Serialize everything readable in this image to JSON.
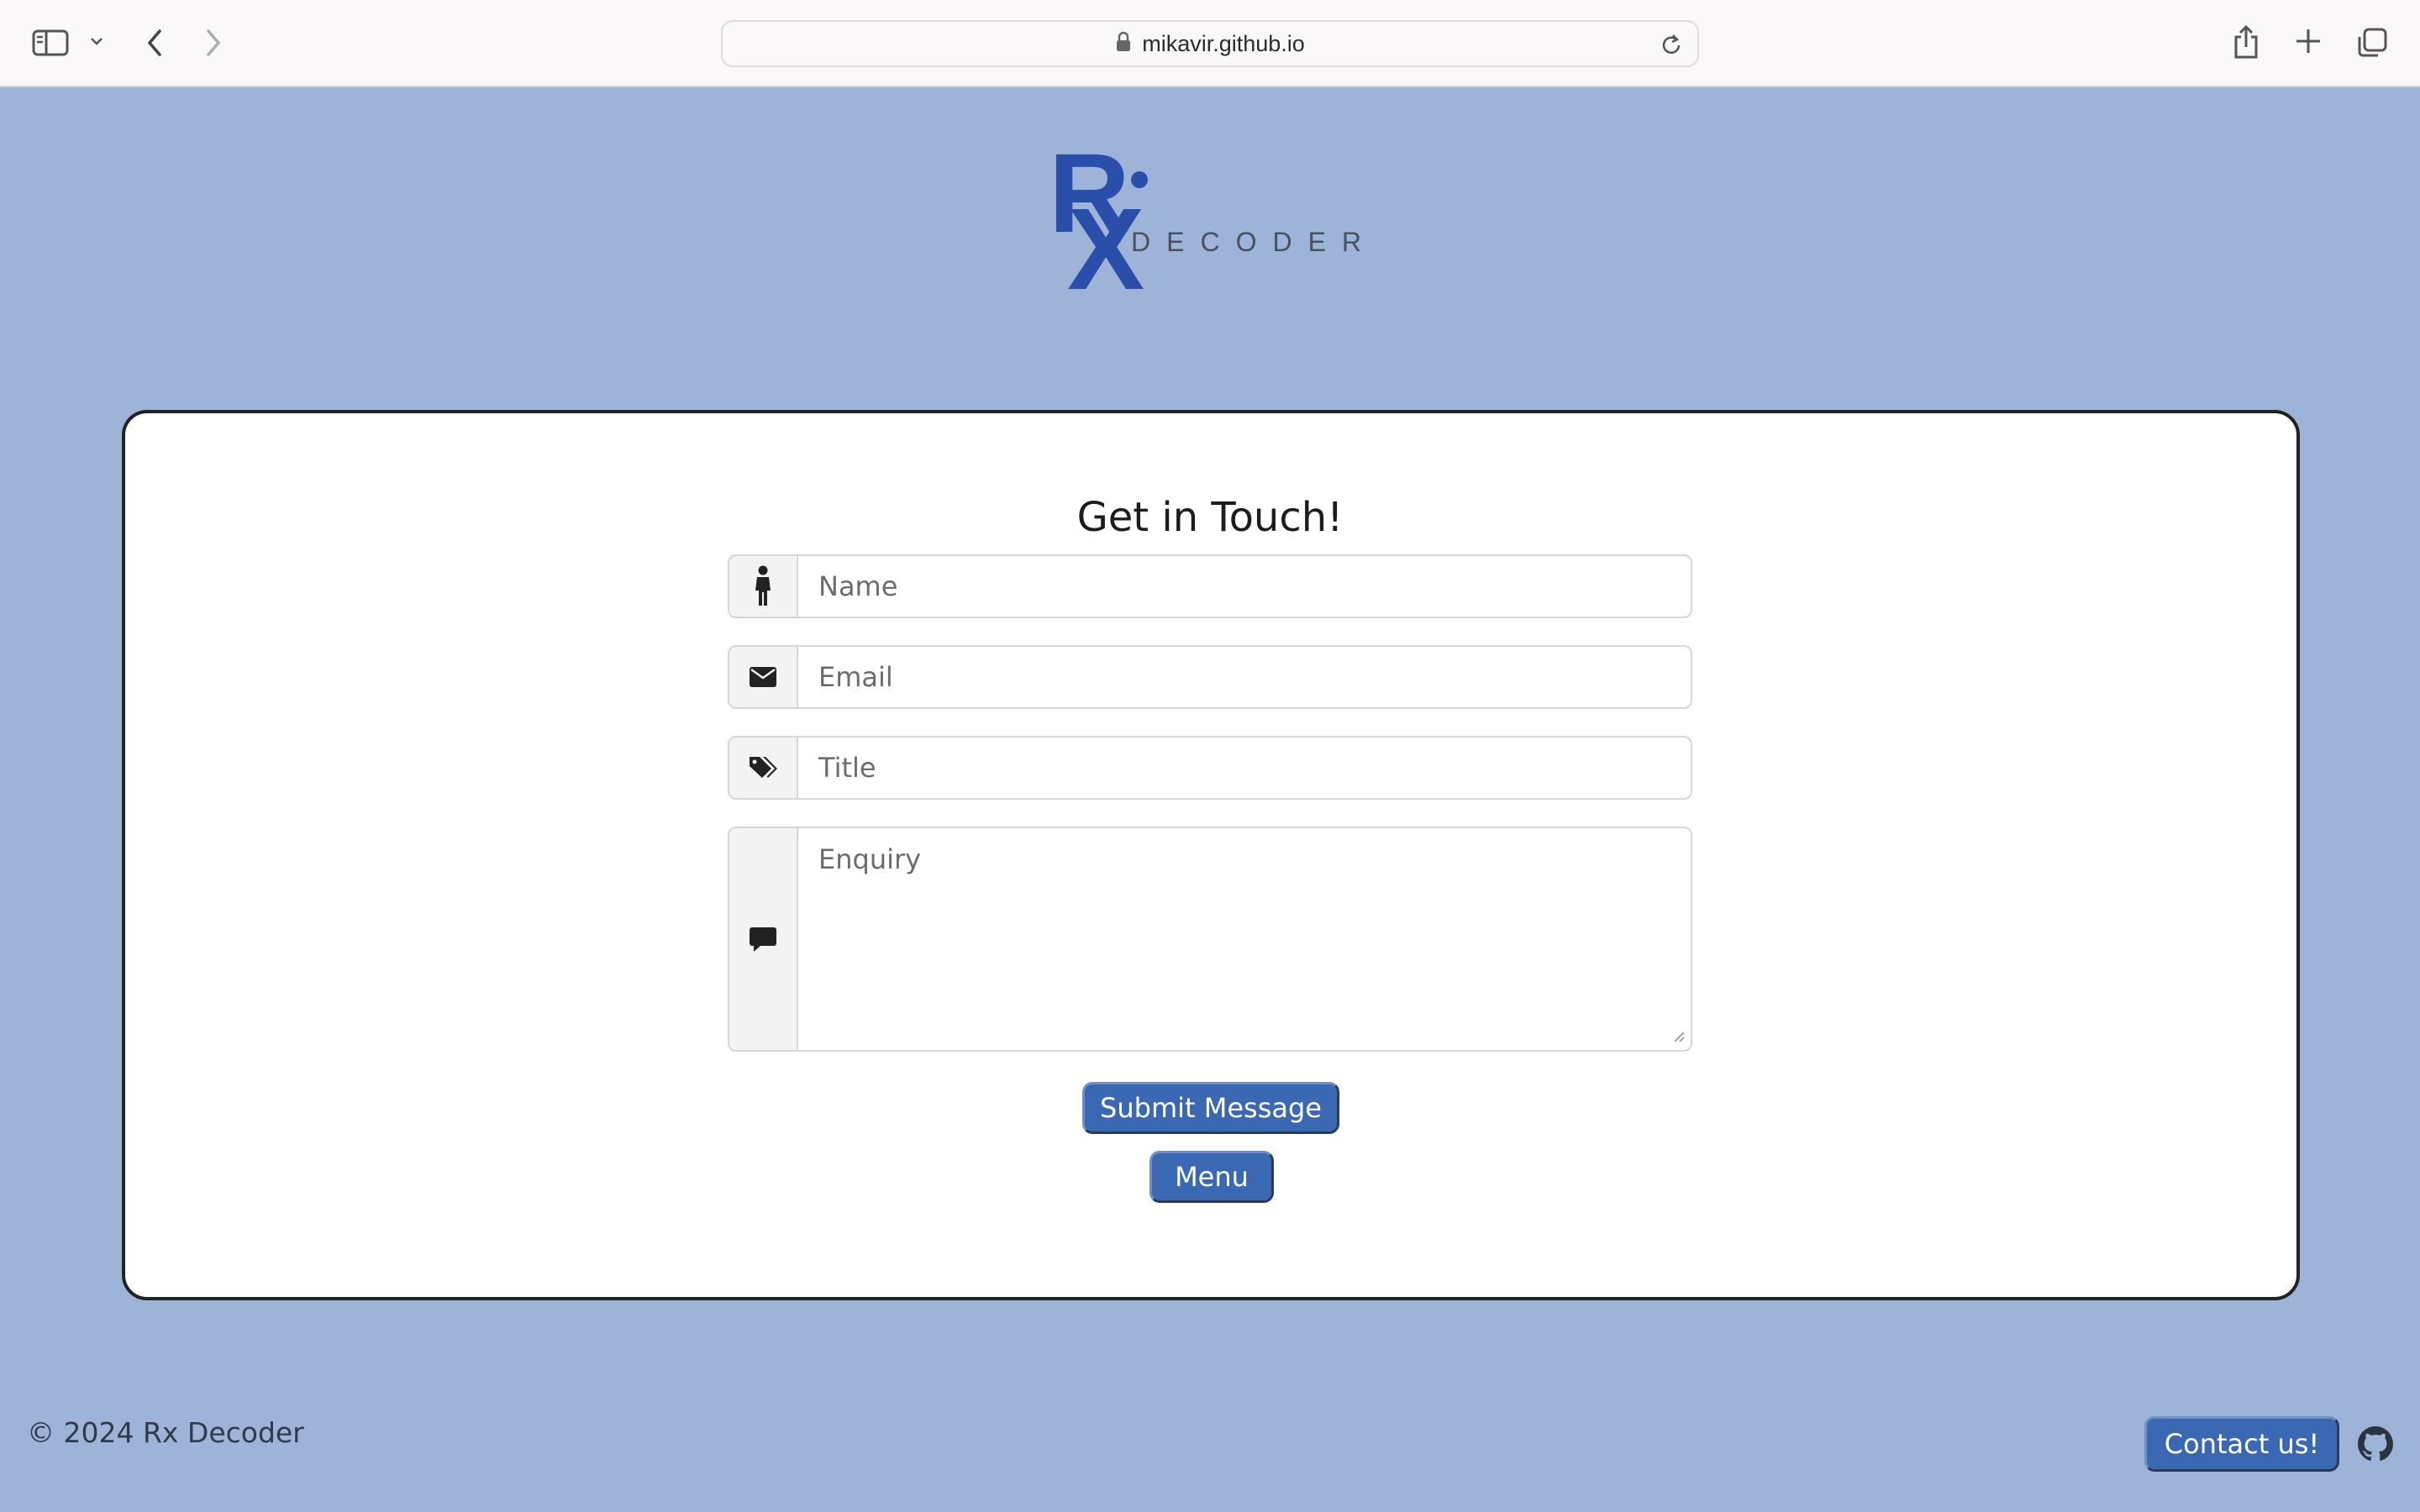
{
  "browser": {
    "url": "mikavir.github.io",
    "icons": {
      "sidebar": "sidebar-icon",
      "dropdown": "chevron-down-icon",
      "back": "back-arrow-icon",
      "forward": "forward-arrow-icon",
      "lock": "lock-icon",
      "reload": "reload-icon",
      "share": "share-icon",
      "new_tab": "plus-icon",
      "tabs": "tab-overview-icon"
    }
  },
  "logo": {
    "letter_r": "R",
    "letter_x": "X",
    "word": "DECODER",
    "color": "#2a4faa"
  },
  "form": {
    "title": "Get in Touch!",
    "name_placeholder": "Name",
    "email_placeholder": "Email",
    "title_placeholder": "Title",
    "enquiry_placeholder": "Enquiry",
    "submit_label": "Submit Message",
    "menu_label": "Menu"
  },
  "footer": {
    "copyright": "© 2024 Rx Decoder",
    "contact_label": "Contact us!",
    "github_icon": "github-icon"
  },
  "colors": {
    "page_background": "#9db4d8",
    "button": "#3a68b3"
  }
}
